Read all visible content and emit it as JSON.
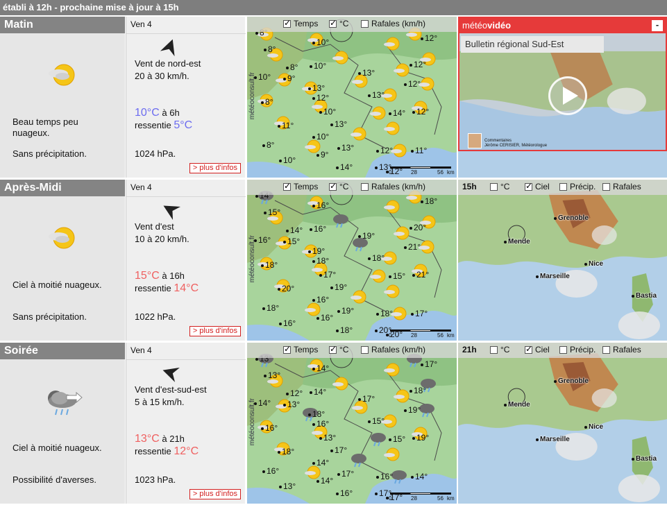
{
  "header": {
    "text": "établi à 12h - prochaine mise à jour à 15h"
  },
  "icons": {
    "sun_icon": "sun-cloud-icon",
    "rain_icon": "cloud-rain-icon",
    "arrow_icon": "wind-arrow-icon",
    "play_icon": "play-icon"
  },
  "colors": {
    "cold": "#6c6cf0",
    "warm": "#ef6060",
    "link": "#d21e1e",
    "video_red": "#e63a3a"
  },
  "map_controls": {
    "temps": "Temps",
    "celsius": "°C",
    "rafales": "Rafales (km/h)",
    "brand": "météoconsult.fr"
  },
  "scale": {
    "zero": "0",
    "mid": "28",
    "max": "56",
    "unit": "km"
  },
  "periods": [
    {
      "title": "Matin",
      "day": "Ven 4",
      "sky_line1": "Beau temps peu",
      "sky_line2": "nuageux.",
      "precip": "Sans précipitation.",
      "wind_dir": "Vent de nord-est",
      "wind_speed": "20 à 30 km/h.",
      "temp": "10°C",
      "temp_time": "à 6h",
      "felt_label": "ressentie",
      "felt": "5°C",
      "pressure": "1024 hPa.",
      "more": "> plus d'infos",
      "map_temps": [
        "8°",
        "10°",
        "12°",
        "8°",
        "8°",
        "10°",
        "13°",
        "12°",
        "10°",
        "9°",
        "8°",
        "13°",
        "12°",
        "10°",
        "14°",
        "11°",
        "8°",
        "10°",
        "12°",
        "13°",
        "9°",
        "12°",
        "13°",
        "10°",
        "14°",
        "13°",
        "11°",
        "12°",
        "13°",
        "12°"
      ]
    },
    {
      "title": "Après-Midi",
      "day": "Ven 4",
      "sky_line1": "Ciel à moitié nuageux.",
      "sky_line2": "",
      "precip": "Sans précipitation.",
      "wind_dir": "Vent d'est",
      "wind_speed": "10 à 20 km/h.",
      "temp": "15°C",
      "temp_time": "à 16h",
      "felt_label": "ressentie",
      "felt": "14°C",
      "pressure": "1022 hPa.",
      "more": "> plus d'infos",
      "map_temps": [
        "14°",
        "16°",
        "18°",
        "15°",
        "14°",
        "16°",
        "19°",
        "20°",
        "16°",
        "15°",
        "18°",
        "19°",
        "21°",
        "17°",
        "15°",
        "20°",
        "18°",
        "16°",
        "21°",
        "18°",
        "16°",
        "18°",
        "19°",
        "16°",
        "18°",
        "20°",
        "17°",
        "18°",
        "19°",
        "20°"
      ]
    },
    {
      "title": "Soirée",
      "day": "Ven 4",
      "sky_line1": "Ciel à moitié nuageux.",
      "sky_line2": "",
      "precip": "Possibilité d'averses.",
      "wind_dir": "Vent d'est-sud-est",
      "wind_speed": "5 à 15 km/h.",
      "temp": "13°C",
      "temp_time": "à 21h",
      "felt_label": "ressentie",
      "felt": "12°C",
      "pressure": "1023 hPa.",
      "more": "> plus d'infos",
      "map_temps": [
        "13°",
        "14°",
        "17°",
        "13°",
        "12°",
        "14°",
        "17°",
        "18°",
        "14°",
        "13°",
        "16°",
        "18°",
        "19°",
        "13°",
        "15°",
        "18°",
        "16°",
        "14°",
        "19°",
        "15°",
        "14°",
        "16°",
        "17°",
        "13°",
        "16°",
        "17°",
        "14°",
        "16°",
        "17°",
        "17°"
      ]
    }
  ],
  "video": {
    "brand_light": "météo",
    "brand_bold": "vidéo",
    "close": "-",
    "title": "Bulletin régional Sud-Est",
    "comment_label": "Commentaires",
    "presenter": "Jérôme CERISIER, Météorologue"
  },
  "radar": [
    {
      "hour": "15h",
      "celsius": "°C",
      "ciel": "Ciel",
      "precip": "Précip.",
      "rafales": "Rafales"
    },
    {
      "hour": "21h",
      "celsius": "°C",
      "ciel": "Ciel",
      "precip": "Précip.",
      "rafales": "Rafales"
    }
  ],
  "cities": {
    "grenoble": "Grenoble",
    "mende": "Mende",
    "nice": "Nice",
    "marseille": "Marseille",
    "bastia": "Bastia"
  }
}
